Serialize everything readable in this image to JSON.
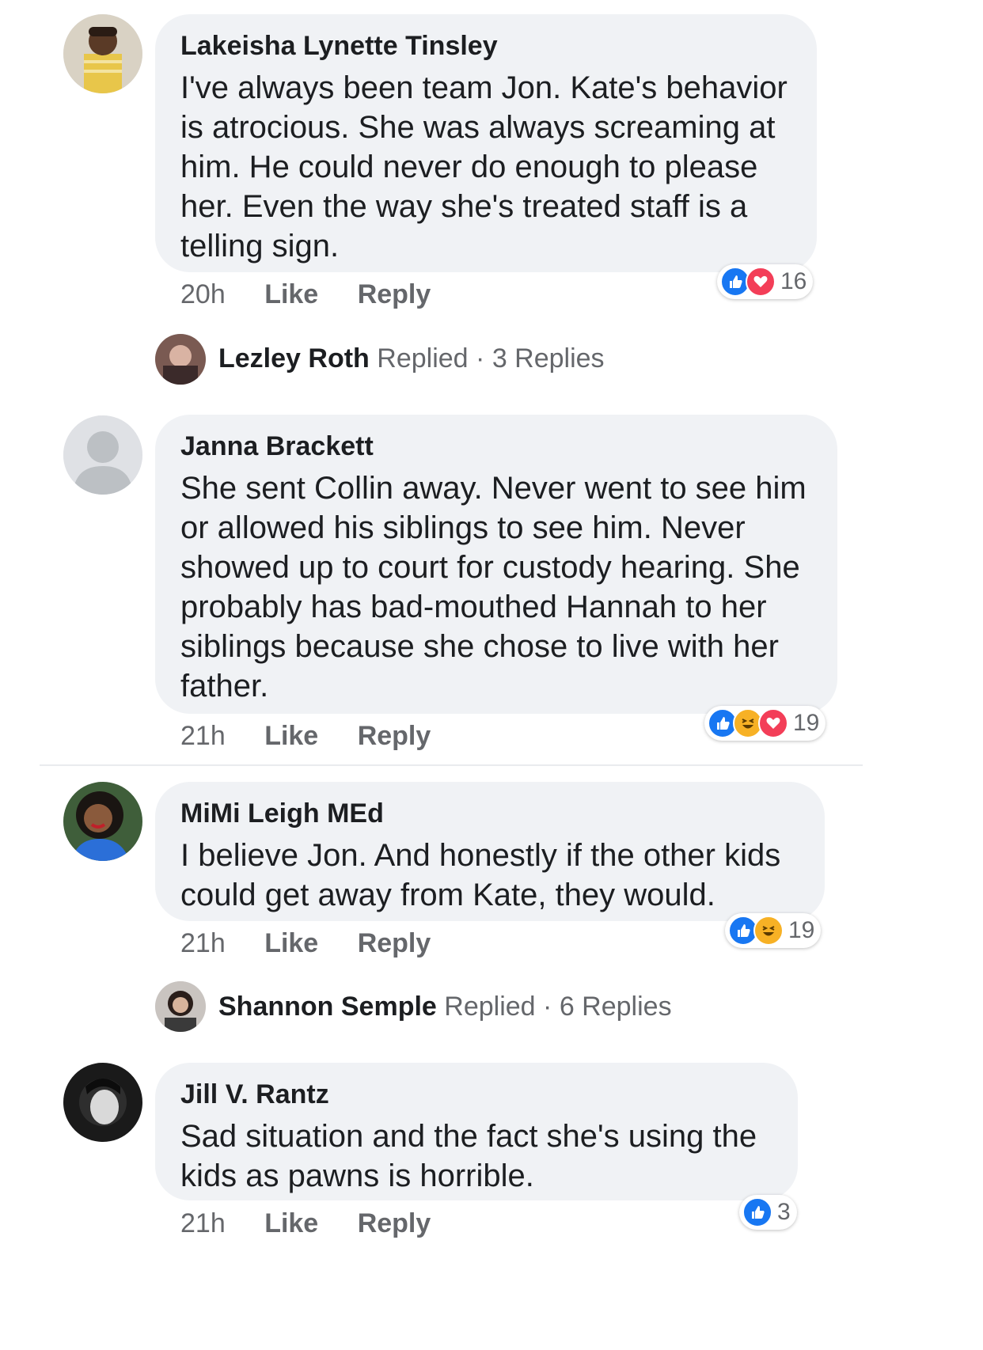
{
  "comments": [
    {
      "author": "Lakeisha Lynette Tinsley",
      "text": "I've always been team Jon. Kate's behavior is atrocious. She was always screaming at him. He could never do enough to please her. Even the way she's treated staff is a telling sign.",
      "time": "20h",
      "like": "Like",
      "reply": "Reply",
      "reaction_count": "16",
      "reactions": [
        "like-icon",
        "love-icon"
      ]
    },
    {
      "author": "Janna Brackett",
      "text": "She sent Collin away. Never went to see him or allowed his siblings to see him. Never showed up to court for custody hearing. She probably has bad-mouthed Hannah to her siblings because she chose to live with her father.",
      "time": "21h",
      "like": "Like",
      "reply": "Reply",
      "reaction_count": "19",
      "reactions": [
        "like-icon",
        "haha-icon",
        "love-icon"
      ]
    },
    {
      "author": "MiMi Leigh MEd",
      "text": "I believe Jon. And honestly if the other kids could get away from Kate, they would.",
      "time": "21h",
      "like": "Like",
      "reply": "Reply",
      "reaction_count": "19",
      "reactions": [
        "like-icon",
        "haha-icon"
      ]
    },
    {
      "author": "Jill V. Rantz",
      "text": "Sad situation and the fact she's using the kids as pawns is horrible.",
      "time": "21h",
      "like": "Like",
      "reply": "Reply",
      "reaction_count": "3",
      "reactions": [
        "like-icon"
      ]
    }
  ],
  "reply_summaries": [
    {
      "name": "Lezley Roth",
      "replied": "Replied",
      "sep": "·",
      "count": "3 Replies"
    },
    {
      "name": "Shannon Semple",
      "replied": "Replied",
      "sep": "·",
      "count": "6 Replies"
    }
  ],
  "colors": {
    "like": "#1877f2",
    "love": "#f33e58",
    "haha": "#f7b125",
    "bubble": "#f0f2f5"
  }
}
